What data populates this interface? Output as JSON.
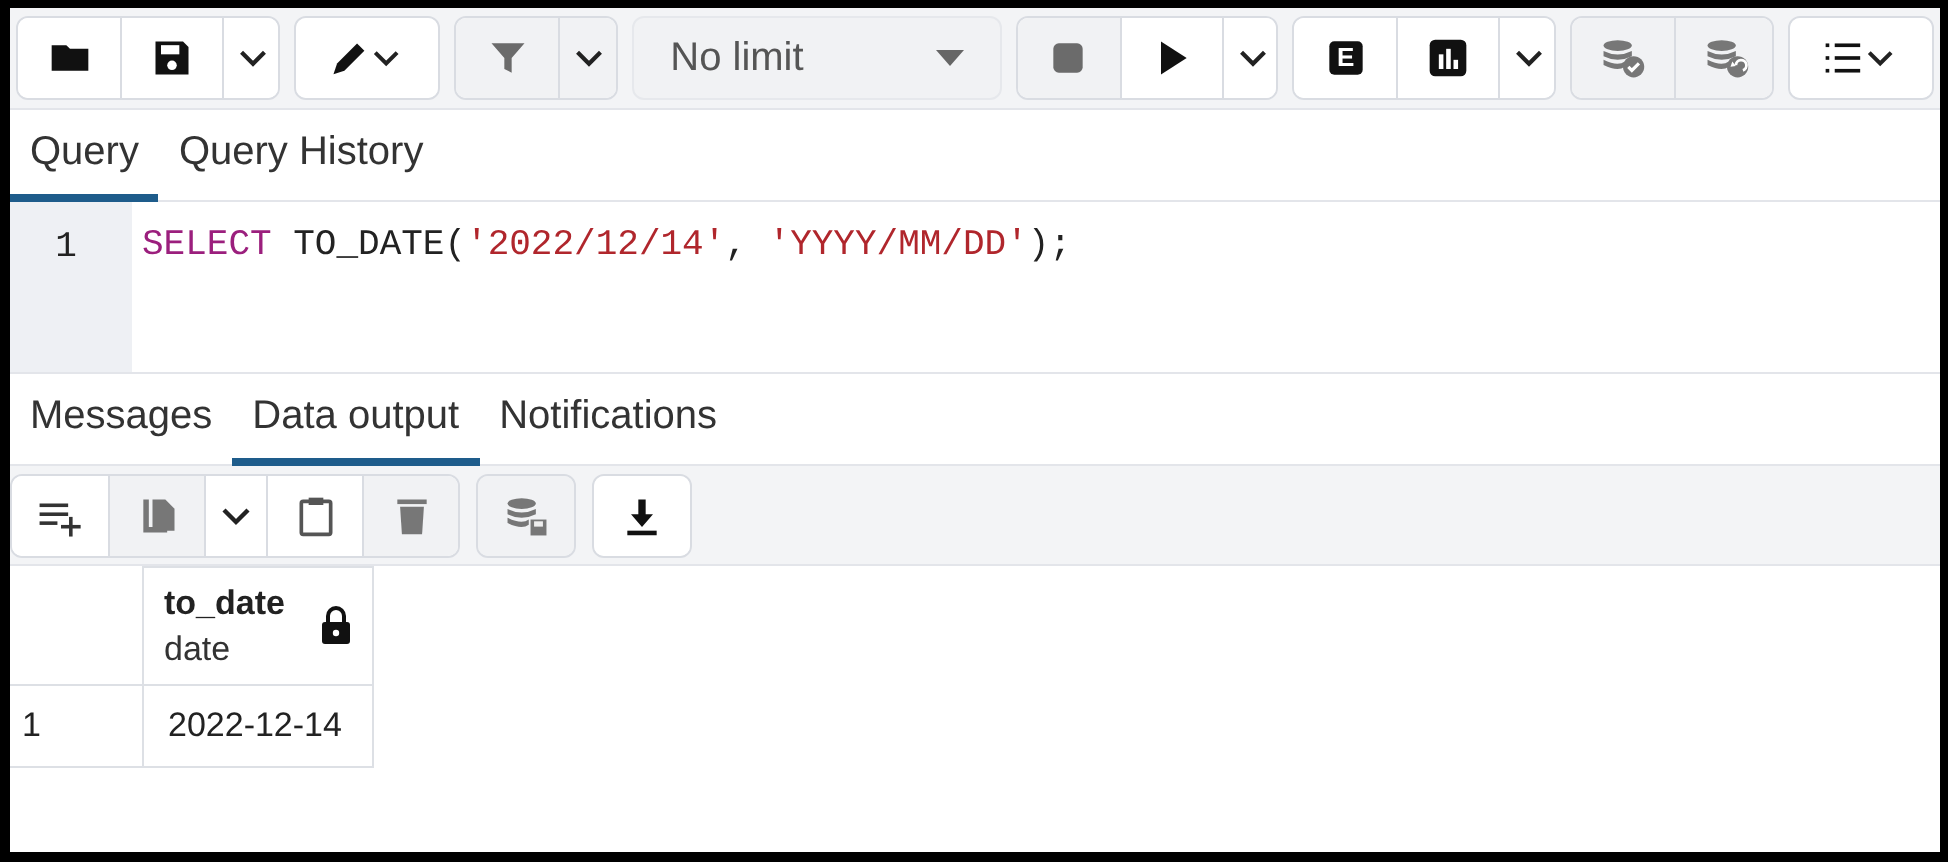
{
  "toolbar": {
    "groups": [
      {
        "buttons": [
          {
            "kind": "folder",
            "disabled": false
          },
          {
            "kind": "save",
            "disabled": false
          },
          {
            "kind": "caret",
            "disabled": false
          }
        ]
      },
      {
        "buttons": [
          {
            "kind": "pencil-caret",
            "disabled": false
          }
        ]
      },
      {
        "buttons": [
          {
            "kind": "filter",
            "disabled": true
          },
          {
            "kind": "caret",
            "disabled": true
          }
        ]
      },
      {
        "select": {
          "value": "No limit"
        }
      },
      {
        "buttons": [
          {
            "kind": "stop",
            "disabled": true
          },
          {
            "kind": "play",
            "disabled": false
          },
          {
            "kind": "caret",
            "disabled": false
          }
        ]
      },
      {
        "buttons": [
          {
            "kind": "explain",
            "label": "E",
            "disabled": false
          },
          {
            "kind": "chart",
            "disabled": false
          },
          {
            "kind": "caret",
            "disabled": false
          }
        ]
      },
      {
        "buttons": [
          {
            "kind": "db-check",
            "disabled": true
          },
          {
            "kind": "db-undo",
            "disabled": true
          }
        ]
      },
      {
        "buttons": [
          {
            "kind": "list-caret",
            "disabled": false
          }
        ]
      }
    ]
  },
  "editor_tabs": [
    {
      "label": "Query",
      "selected": true
    },
    {
      "label": "Query History",
      "selected": false
    }
  ],
  "editor": {
    "lines": [
      {
        "number": "1",
        "tokens": [
          {
            "kind": "keyword",
            "text": "SELECT"
          },
          {
            "kind": "plain",
            "text": " TO_DATE("
          },
          {
            "kind": "string",
            "text": "'2022/12/14'"
          },
          {
            "kind": "plain",
            "text": ", "
          },
          {
            "kind": "string",
            "text": "'YYYY/MM/DD'"
          },
          {
            "kind": "plain",
            "text": ");"
          }
        ]
      }
    ]
  },
  "output_tabs": [
    {
      "label": "Messages",
      "selected": false
    },
    {
      "label": "Data output",
      "selected": true
    },
    {
      "label": "Notifications",
      "selected": false
    }
  ],
  "output_toolbar": {
    "groups": [
      {
        "buttons": [
          {
            "kind": "add-row",
            "disabled": false
          },
          {
            "kind": "copy",
            "disabled": true
          },
          {
            "kind": "caret",
            "disabled": false
          },
          {
            "kind": "paste",
            "disabled": false
          },
          {
            "kind": "delete",
            "disabled": true
          }
        ]
      },
      {
        "buttons": [
          {
            "kind": "db-save",
            "disabled": true
          }
        ]
      },
      {
        "buttons": [
          {
            "kind": "download",
            "disabled": false
          }
        ]
      }
    ]
  },
  "table": {
    "columns": [
      {
        "name": "to_date",
        "type": "date",
        "locked": true
      }
    ],
    "rows": [
      {
        "number": "1",
        "cells": [
          "2022-12-14"
        ]
      }
    ]
  }
}
